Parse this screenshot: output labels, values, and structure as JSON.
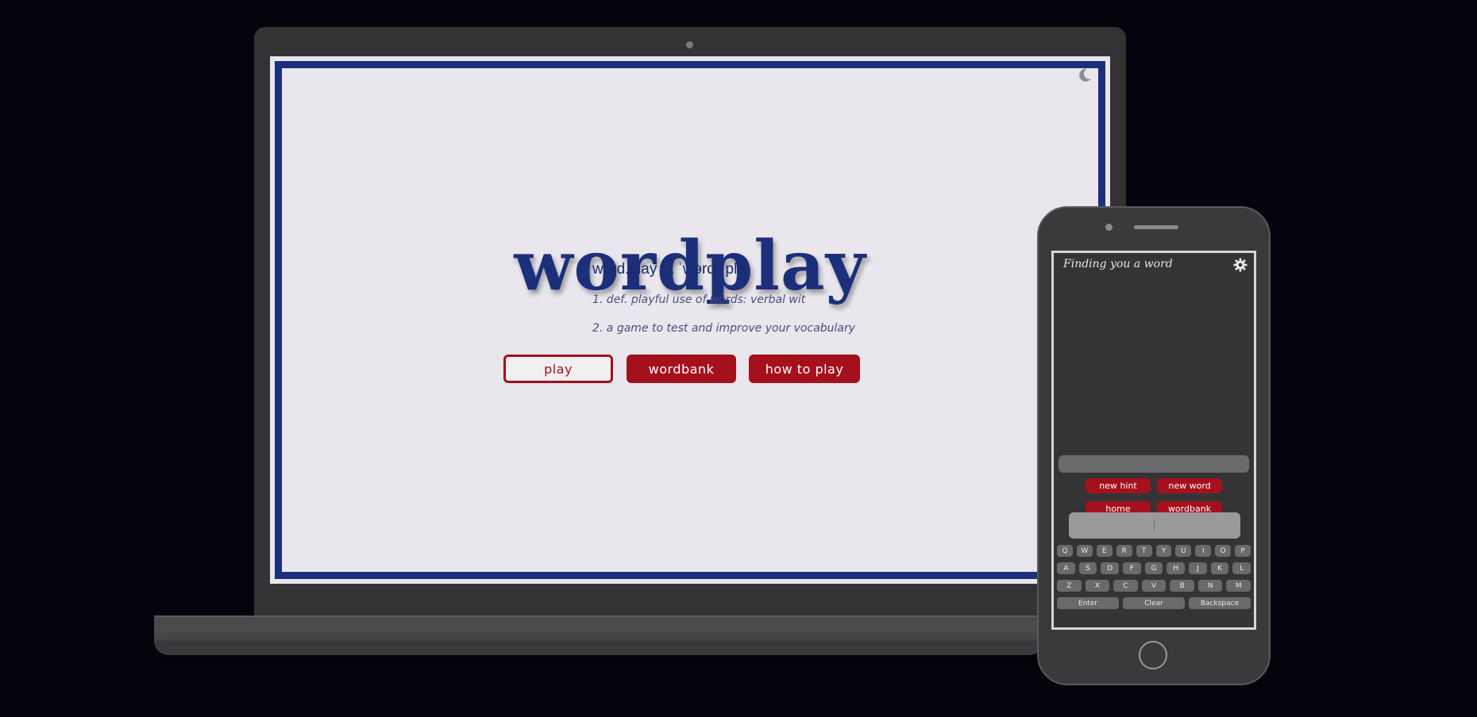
{
  "laptop": {
    "title": "wordplay",
    "pronunciation": "word.play | \\ ˈwərd-ˌplā",
    "definitions": [
      "1. def. playful use of words: verbal wit",
      "2. a game to test and improve your vocabulary"
    ],
    "buttons": {
      "play": "play",
      "wordbank": "wordbank",
      "how_to_play": "how to play"
    },
    "theme_toggle_icon": "moon-icon",
    "colors": {
      "accent_blue": "#1c2f7a",
      "accent_red": "#a5101d"
    }
  },
  "phone": {
    "title": "Finding you a word",
    "settings_icon": "gear-icon",
    "buttons": {
      "new_hint": "new hint",
      "new_word": "new word",
      "home": "home",
      "wordbank": "wordbank"
    },
    "keyboard": {
      "row1": [
        "Q",
        "W",
        "E",
        "R",
        "T",
        "Y",
        "U",
        "I",
        "O",
        "P"
      ],
      "row2": [
        "A",
        "S",
        "D",
        "F",
        "G",
        "H",
        "J",
        "K",
        "L"
      ],
      "row3": [
        "Z",
        "X",
        "C",
        "V",
        "B",
        "N",
        "M"
      ],
      "row4": [
        "Enter",
        "Clear",
        "Backspace"
      ]
    }
  }
}
